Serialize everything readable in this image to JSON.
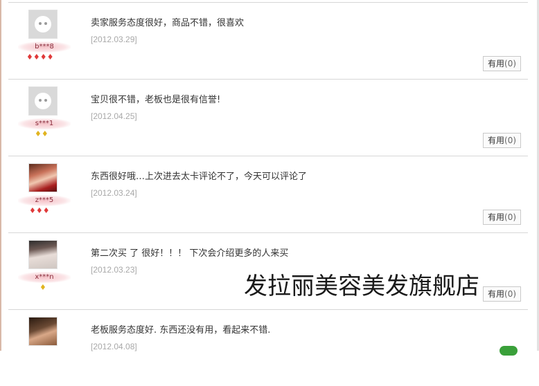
{
  "reviews": [
    {
      "avatar": "default-avatar",
      "username": "b***8",
      "badge": "♦♦♦♦",
      "badge_color": "#e03a3a",
      "comment": "卖家服务态度很好，商品不错，很喜欢",
      "date": "[2012.03.29]",
      "useful_label": "有用",
      "useful_count": "(0)"
    },
    {
      "avatar": "default-avatar",
      "username": "s***1",
      "badge": "♦♦",
      "badge_color": "#e1b420",
      "comment": "宝贝很不错，老板也是很有信誉!",
      "date": "[2012.04.25]",
      "useful_label": "有用",
      "useful_count": "(0)"
    },
    {
      "avatar": "photo-avatar",
      "username": "z***5",
      "badge": "♦♦♦",
      "badge_color": "#e03a3a",
      "comment": "东西很好哦…上次进去太卡评论不了，今天可以评论了",
      "date": "[2012.03.24]",
      "useful_label": "有用",
      "useful_count": "(0)"
    },
    {
      "avatar": "photo-avatar",
      "username": "x***n",
      "badge": "♦",
      "badge_color": "#e1b420",
      "comment": "第二次买 了 很好！！！ 下次会介绍更多的人来买",
      "date": "[2012.03.23]",
      "useful_label": "有用",
      "useful_count": "(0)"
    },
    {
      "avatar": "photo-avatar",
      "username": "",
      "badge": "",
      "badge_color": "#e03a3a",
      "comment": "老板服务态度好. 东西还没有用，看起来不错.",
      "date": "[2012.04.08]",
      "useful_label": "",
      "useful_count": ""
    }
  ],
  "watermark": "发拉丽美容美发旗舰店"
}
